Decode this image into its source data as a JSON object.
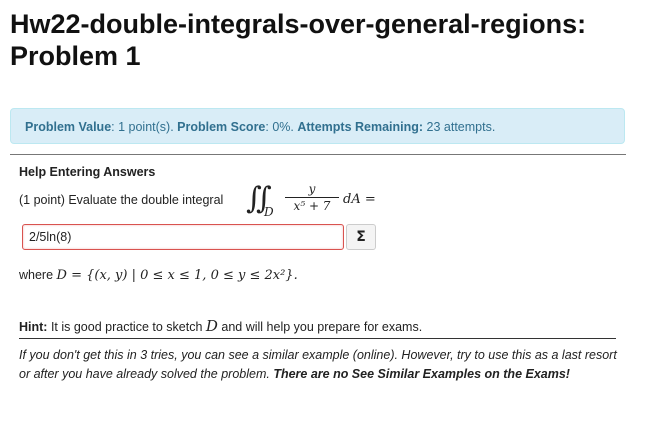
{
  "header": {
    "title": "Hw22-double-integrals-over-general-regions:",
    "subtitle": "Problem 1"
  },
  "info": {
    "value_label": "Problem Value",
    "value_text": ": 1 point(s). ",
    "score_label": "Problem Score",
    "score_text": ": 0%. ",
    "attempts_label": "Attempts Remaining:",
    "attempts_text": " 23 attempts."
  },
  "help": {
    "label": "Help Entering Answers"
  },
  "problem": {
    "intro": "(1 point) Evaluate the double integral",
    "integral_symbol": "∬",
    "region_sub": "D",
    "numerator": "y",
    "denominator": "x⁵ + 7",
    "differential": "dA ="
  },
  "answer": {
    "value": "2/5ln(8)",
    "equation_button_label": "Σ"
  },
  "region": {
    "prefix": "where ",
    "set": "D = {(x, y) | 0 ≤ x ≤ 1, 0 ≤ y ≤ 2x²}."
  },
  "hint": {
    "label": "Hint:",
    "text_before": " It is good practice to sketch ",
    "var": "D",
    "text_after": " and will help you prepare for exams."
  },
  "note": {
    "text": "If you don't get this in 3 tries, you can see a similar example (online). However, try to use this as a last resort or after you have already solved the problem. ",
    "bold": "There are no See Similar Examples on the Exams!"
  }
}
